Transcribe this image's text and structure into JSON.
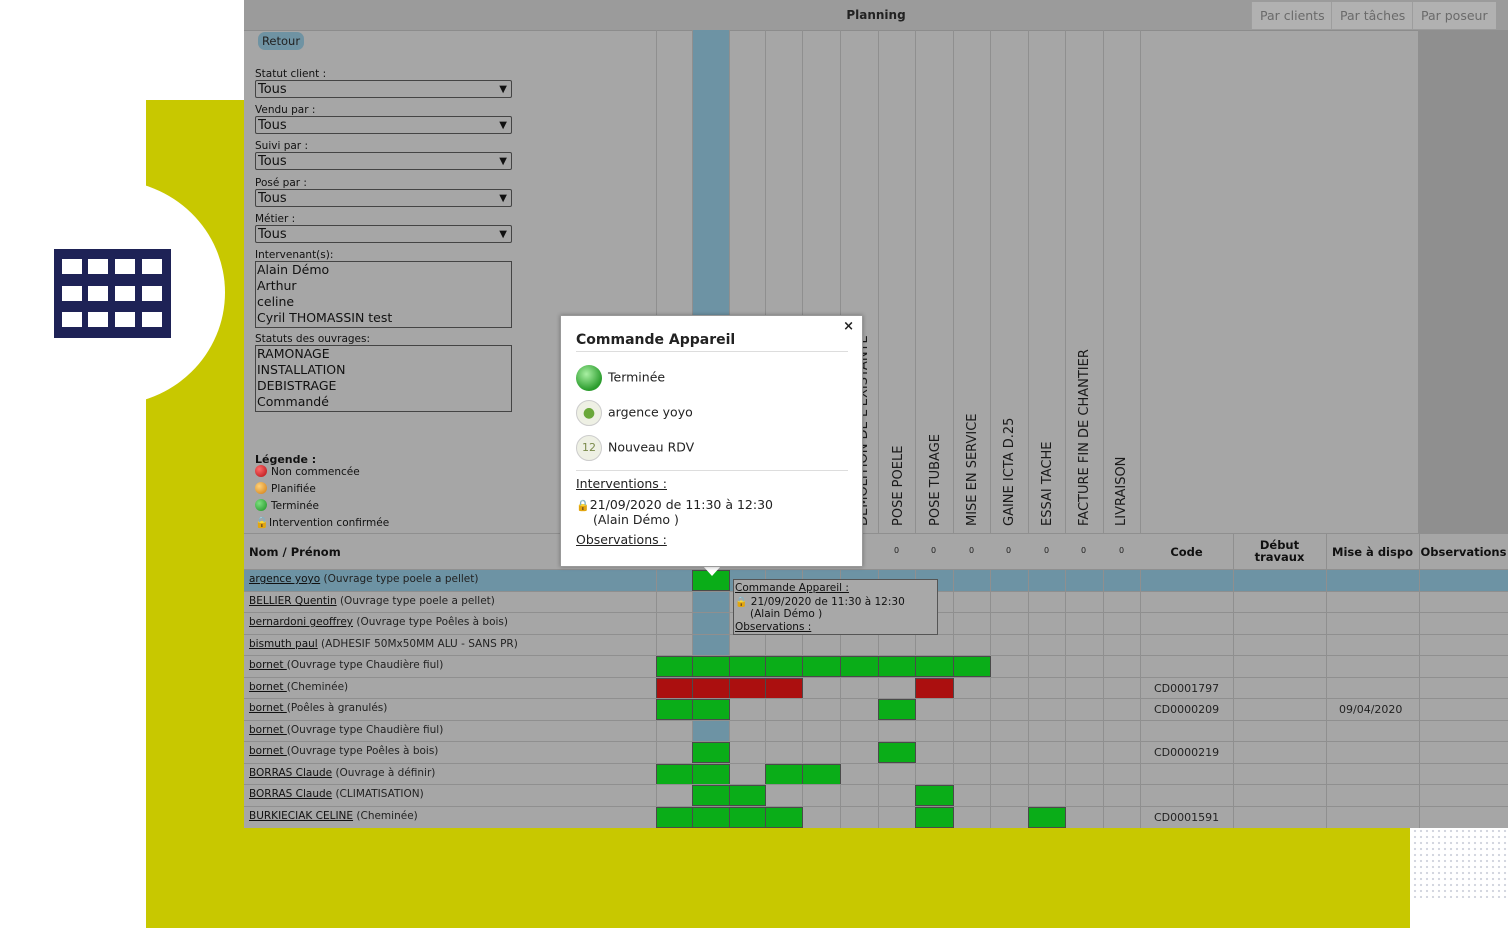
{
  "window": {
    "title": "Planning"
  },
  "view_tabs": [
    "Par clients",
    "Par tâches",
    "Par poseur"
  ],
  "back_button": "Retour",
  "filters": [
    {
      "label": "Statut client :",
      "value": "Tous"
    },
    {
      "label": "Vendu par :",
      "value": "Tous"
    },
    {
      "label": "Suivi par :",
      "value": "Tous"
    },
    {
      "label": "Posé par :",
      "value": "Tous"
    },
    {
      "label": "Métier :",
      "value": "Tous"
    }
  ],
  "intervenants": {
    "label": "Intervenant(s):",
    "items": [
      "Alain Démo",
      "Arthur",
      "celine",
      "Cyril THOMASSIN test"
    ]
  },
  "statuts": {
    "label": "Statuts des ouvrages:",
    "items": [
      "RAMONAGE",
      "INSTALLATION",
      "DEBISTRAGE",
      "Commandé"
    ]
  },
  "legend": {
    "title": "Légende :",
    "items": [
      {
        "label": "Non commencée",
        "color": "#c0141a"
      },
      {
        "label": "Planifiée",
        "color": "#e39020"
      },
      {
        "label": "Terminée",
        "color": "#1f9e2a"
      },
      {
        "label": "Intervention confirmée",
        "icon": "lock-icon"
      }
    ]
  },
  "task_columns": [
    "DEMOLITION DE L'EXISTANTE",
    "POSE POELE",
    "POSE TUBAGE",
    "MISE EN SERVICE",
    "GAINE ICTA D.25",
    "ESSAI TACHE",
    "FACTURE FIN DE CHANTIER",
    "LIVRAISON"
  ],
  "task_counts": [
    "0",
    "0",
    "0",
    "0",
    "0",
    "0",
    "0"
  ],
  "table_headers": {
    "name": "Nom / Prénom",
    "code": "Code",
    "debut": "Début travaux",
    "dispo": "Mise à dispo",
    "obs": "Observations"
  },
  "rows": [
    {
      "name": "argence yoyo",
      "detail": " (Ouvrage type poele a pellet)",
      "code": "",
      "dispo": "",
      "cells": [
        "",
        "g",
        "",
        "",
        "",
        "",
        "",
        "",
        "",
        "",
        "",
        "",
        "",
        ""
      ]
    },
    {
      "name": "BELLIER Quentin",
      "detail": " (Ouvrage type poele a pellet)",
      "code": "",
      "dispo": "",
      "cells": [
        "",
        "",
        "",
        "",
        "",
        "",
        "",
        "",
        "",
        "",
        "",
        "",
        "",
        ""
      ]
    },
    {
      "name": "bernardoni geoffrey",
      "detail": " (Ouvrage type Poêles à bois)",
      "code": "",
      "dispo": "",
      "cells": [
        "",
        "",
        "",
        "",
        "",
        "",
        "",
        "",
        "",
        "",
        "",
        "",
        "",
        ""
      ]
    },
    {
      "name": "bismuth paul",
      "detail": " (ADHESIF 50Mx50MM ALU - SANS PR)",
      "code": "",
      "dispo": "",
      "cells": [
        "",
        "",
        "",
        "",
        "",
        "",
        "",
        "",
        "",
        "",
        "",
        "",
        "",
        ""
      ]
    },
    {
      "name": "bornet ",
      "detail": "(Ouvrage type Chaudière fiul)",
      "code": "",
      "dispo": "",
      "cells": [
        "g",
        "g",
        "g",
        "g",
        "g",
        "g",
        "g",
        "g",
        "g",
        "",
        "",
        "",
        "",
        ""
      ]
    },
    {
      "name": "bornet ",
      "detail": "(Cheminée)",
      "code": "CD0001797",
      "dispo": "",
      "cells": [
        "r",
        "r",
        "r",
        "r",
        "",
        "",
        "",
        "r",
        "",
        "",
        "",
        "",
        "",
        ""
      ]
    },
    {
      "name": "bornet ",
      "detail": "(Poêles à granulés)",
      "code": "CD0000209",
      "dispo": "09/04/2020",
      "cells": [
        "g",
        "g",
        "",
        "",
        "",
        "",
        "g",
        "",
        "",
        "",
        "",
        "",
        "",
        ""
      ]
    },
    {
      "name": "bornet ",
      "detail": "(Ouvrage type Chaudière fiul)",
      "code": "",
      "dispo": "",
      "cells": [
        "",
        "",
        "",
        "",
        "",
        "",
        "",
        "",
        "",
        "",
        "",
        "",
        "",
        ""
      ]
    },
    {
      "name": "bornet ",
      "detail": "(Ouvrage type Poêles à bois)",
      "code": "CD0000219",
      "dispo": "",
      "cells": [
        "",
        "g",
        "",
        "",
        "",
        "",
        "g",
        "",
        "",
        "",
        "",
        "",
        "",
        ""
      ]
    },
    {
      "name": "BORRAS Claude",
      "detail": " (Ouvrage à définir)",
      "code": "",
      "dispo": "",
      "cells": [
        "g",
        "g",
        "",
        "g",
        "g",
        "",
        "",
        "",
        "",
        "",
        "",
        "",
        "",
        ""
      ]
    },
    {
      "name": "BORRAS Claude",
      "detail": " (CLIMATISATION)",
      "code": "",
      "dispo": "",
      "cells": [
        "",
        "g",
        "g",
        "",
        "",
        "",
        "",
        "g",
        "",
        "",
        "",
        "",
        "",
        ""
      ]
    },
    {
      "name": "BURKIECIAK CELINE",
      "detail": " (Cheminée)",
      "code": "CD0001591",
      "dispo": "",
      "cells": [
        "g",
        "g",
        "g",
        "g",
        "",
        "",
        "",
        "g",
        "",
        "",
        "g",
        "",
        "",
        ""
      ]
    }
  ],
  "tooltip": {
    "title": "Commande Appareil :",
    "datetime": "21/09/2020 de 11:30 à 12:30",
    "person": "(Alain Démo )",
    "obs": "Observations :"
  },
  "popup": {
    "title": "Commande Appareil",
    "status": "Terminée",
    "client": "argence yoyo",
    "rdv": "Nouveau RDV",
    "interventions_label": "Interventions :",
    "datetime": "21/09/2020 de 11:30 à 12:30",
    "person": "(Alain Démo )",
    "observations_label": "Observations :",
    "close": "×"
  },
  "colors": {
    "brand_yellow": "#c8c800",
    "navy": "#1e2256",
    "selection": "#6d93a4",
    "done_green": "#0aad18",
    "todo_red": "#ab0f0f"
  }
}
